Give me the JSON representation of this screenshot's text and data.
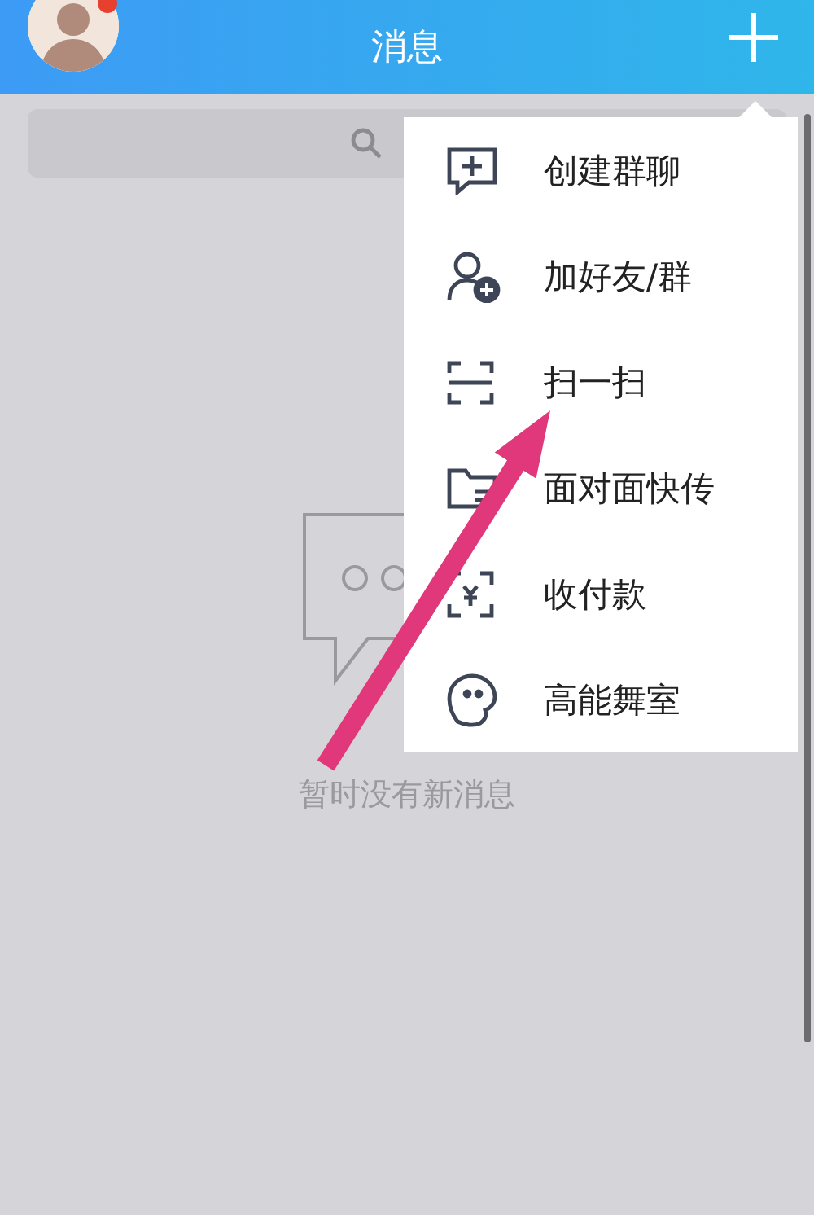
{
  "header": {
    "title": "消息"
  },
  "menu": {
    "items": [
      {
        "label": "创建群聊"
      },
      {
        "label": "加好友/群"
      },
      {
        "label": "扫一扫"
      },
      {
        "label": "面对面快传"
      },
      {
        "label": "收付款"
      },
      {
        "label": "高能舞室"
      }
    ]
  },
  "empty_state": {
    "message": "暂时没有新消息"
  }
}
